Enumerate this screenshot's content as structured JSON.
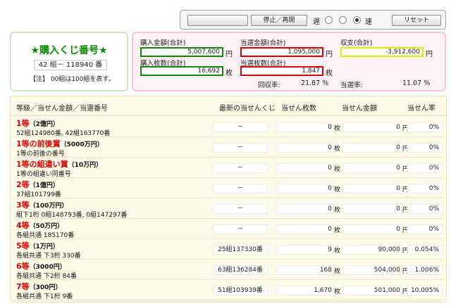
{
  "controls": {
    "blank_button": "",
    "stop_button": "停止／再開",
    "slow_label": "遅",
    "fast_label": "速",
    "reset_button": "リセット",
    "speed_selected": 3
  },
  "number_panel": {
    "title": "★購入くじ番号★",
    "number": "42 組－ 118940 番",
    "note": "【注】 00組は100組を表す。"
  },
  "summary": {
    "purchase_amount_label": "購入金額(合計)",
    "purchase_amount": "5,007,600",
    "purchase_amount_unit": "円",
    "win_amount_label": "当選金額(合計)",
    "win_amount": "1,095,000",
    "win_amount_unit": "円",
    "balance_label": "収支(合計)",
    "balance": "-3,912,600",
    "balance_unit": "円",
    "purchase_count_label": "購入枚数(合計)",
    "purchase_count": "16,692",
    "purchase_count_unit": "枚",
    "win_count_label": "当選枚数(合計)",
    "win_count": "1,847",
    "win_count_unit": "枚",
    "recovery_rate_label": "回収率:",
    "recovery_rate": "21.87 %",
    "win_rate_label": "当選率:",
    "win_rate": "11.07 %",
    "colors": {
      "green": "#0e8a00",
      "red": "#d80000",
      "yellow": "#e8e800"
    }
  },
  "table": {
    "headers": {
      "grade": "等級／当せん金額／当選番号",
      "latest": "最新の当せんくじ",
      "count": "当せん枚数",
      "amount": "当せん金額",
      "rate": "当せん率"
    },
    "rows": [
      {
        "name": "1等",
        "prize": "（2億円）",
        "numbers": "52組124980番, 42組163770番",
        "latest": "－",
        "count": "0",
        "count_unit": "枚",
        "amount": "0",
        "amount_unit": "円",
        "rate": "0%"
      },
      {
        "name": "1等の前後賞",
        "prize": "（5000万円）",
        "numbers": "1等の前後の番号",
        "latest": "－",
        "count": "0",
        "count_unit": "枚",
        "amount": "0",
        "amount_unit": "円",
        "rate": "0%"
      },
      {
        "name": "1等の組違い賞",
        "prize": "（10万円）",
        "numbers": "1等の組違い同番号",
        "latest": "－",
        "count": "0",
        "count_unit": "枚",
        "amount": "0",
        "amount_unit": "円",
        "rate": "0%"
      },
      {
        "name": "2等",
        "prize": "（1億円）",
        "numbers": "37組101799番",
        "latest": "－",
        "count": "0",
        "count_unit": "枚",
        "amount": "0",
        "amount_unit": "円",
        "rate": "0%"
      },
      {
        "name": "3等",
        "prize": "（100万円）",
        "numbers": "組下1桁 0組148793番, 0組147297番",
        "latest": "－",
        "count": "0",
        "count_unit": "枚",
        "amount": "0",
        "amount_unit": "円",
        "rate": "0%"
      },
      {
        "name": "4等",
        "prize": "（50万円）",
        "numbers": "各組共通 185170番",
        "latest": "－",
        "count": "0",
        "count_unit": "枚",
        "amount": "0",
        "amount_unit": "円",
        "rate": "0%"
      },
      {
        "name": "5等",
        "prize": "（1万円）",
        "numbers": "各組共通 下3桁 330番",
        "latest": "25組137330番",
        "count": "9",
        "count_unit": "枚",
        "amount": "90,000",
        "amount_unit": "円",
        "rate": "0.054%"
      },
      {
        "name": "6等",
        "prize": "（3000円）",
        "numbers": "各組共通 下2桁 84番",
        "latest": "63組136284番",
        "count": "168",
        "count_unit": "枚",
        "amount": "504,000",
        "amount_unit": "円",
        "rate": "1.006%"
      },
      {
        "name": "7等",
        "prize": "（300円）",
        "numbers": "各組共通 下1桁 9番",
        "latest": "51組103939番",
        "count": "1,670",
        "count_unit": "枚",
        "amount": "501,000",
        "amount_unit": "円",
        "rate": "10.005%"
      }
    ]
  }
}
